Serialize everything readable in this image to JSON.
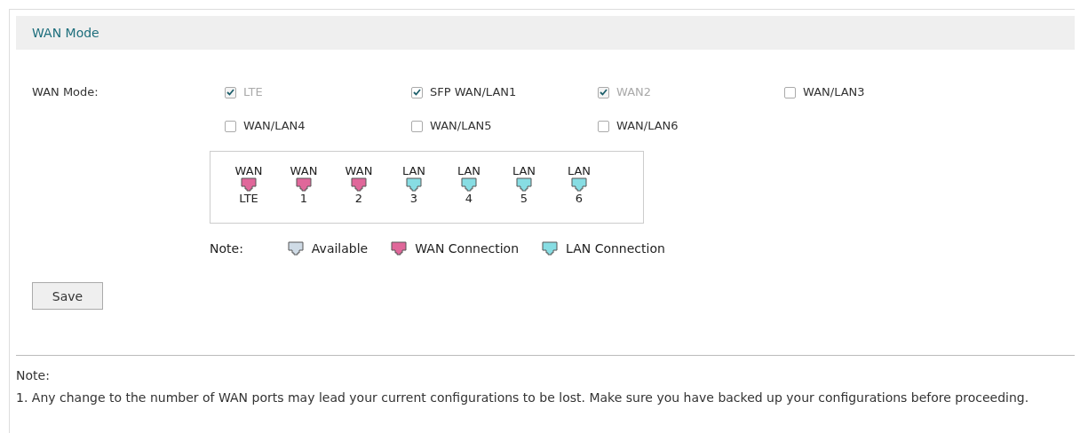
{
  "section": {
    "title": "WAN Mode"
  },
  "wan_mode": {
    "label": "WAN Mode:",
    "options": [
      {
        "label": "LTE",
        "checked": true,
        "disabled": true
      },
      {
        "label": "SFP WAN/LAN1",
        "checked": true,
        "disabled": false
      },
      {
        "label": "WAN2",
        "checked": true,
        "disabled": true
      },
      {
        "label": "WAN/LAN3",
        "checked": false,
        "disabled": false
      },
      {
        "label": "WAN/LAN4",
        "checked": false,
        "disabled": false
      },
      {
        "label": "WAN/LAN5",
        "checked": false,
        "disabled": false
      },
      {
        "label": "WAN/LAN6",
        "checked": false,
        "disabled": false
      }
    ]
  },
  "ports": [
    {
      "role": "WAN",
      "name": "LTE",
      "kind": "wan"
    },
    {
      "role": "WAN",
      "name": "1",
      "kind": "wan"
    },
    {
      "role": "WAN",
      "name": "2",
      "kind": "wan"
    },
    {
      "role": "LAN",
      "name": "3",
      "kind": "lan"
    },
    {
      "role": "LAN",
      "name": "4",
      "kind": "lan"
    },
    {
      "role": "LAN",
      "name": "5",
      "kind": "lan"
    },
    {
      "role": "LAN",
      "name": "6",
      "kind": "lan"
    }
  ],
  "legend": {
    "label": "Note:",
    "items": [
      {
        "label": "Available",
        "kind": "available"
      },
      {
        "label": "WAN Connection",
        "kind": "wan"
      },
      {
        "label": "LAN Connection",
        "kind": "lan"
      }
    ]
  },
  "save_button": "Save",
  "footer_note": {
    "title": "Note:",
    "text": "1. Any change to the number of WAN ports may lead your current configurations to be lost. Make sure you have backed up your configurations before proceeding."
  }
}
